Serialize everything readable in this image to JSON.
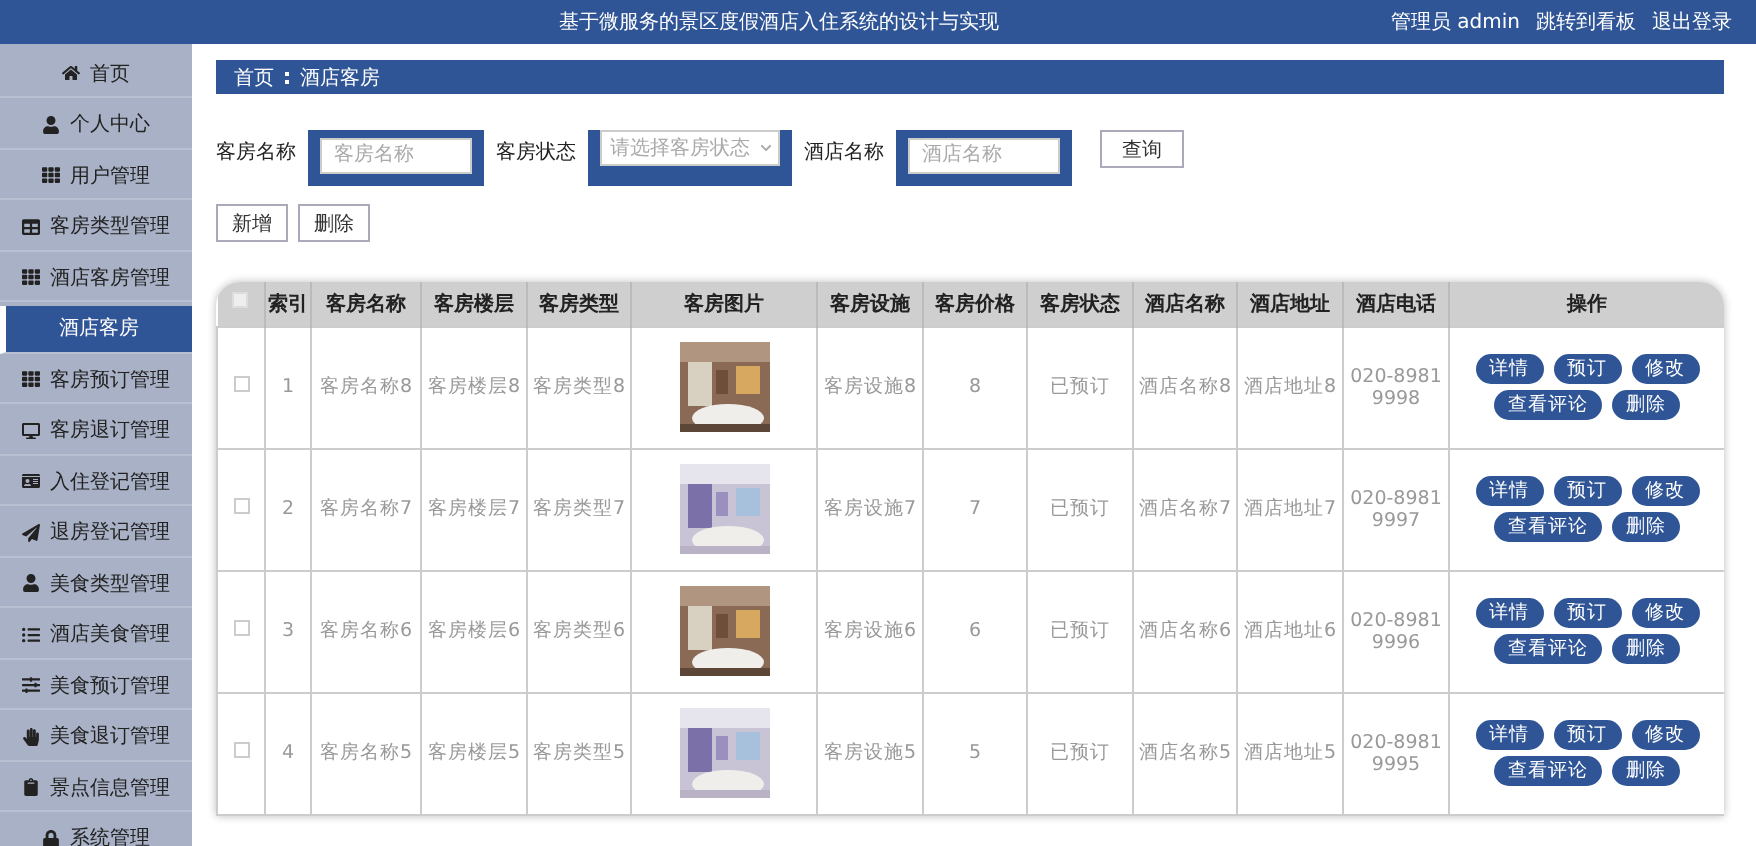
{
  "header": {
    "title": "基于微服务的景区度假酒店入住系统的设计与实现",
    "user": "管理员 admin",
    "links": [
      "跳转到看板",
      "退出登录"
    ]
  },
  "sidebar": {
    "items": [
      {
        "label": "首页",
        "selected": false
      },
      {
        "label": "个人中心",
        "selected": false
      },
      {
        "label": "用户管理",
        "selected": false
      },
      {
        "label": "客房类型管理",
        "selected": false
      },
      {
        "label": "酒店客房管理",
        "selected": false
      },
      {
        "label": "酒店客房",
        "selected": true
      },
      {
        "label": "客房预订管理",
        "selected": false
      },
      {
        "label": "客房退订管理",
        "selected": false
      },
      {
        "label": "入住登记管理",
        "selected": false
      },
      {
        "label": "退房登记管理",
        "selected": false
      },
      {
        "label": "美食类型管理",
        "selected": false
      },
      {
        "label": "酒店美食管理",
        "selected": false
      },
      {
        "label": "美食预订管理",
        "selected": false
      },
      {
        "label": "美食退订管理",
        "selected": false
      },
      {
        "label": "景点信息管理",
        "selected": false
      },
      {
        "label": "系统管理",
        "selected": false
      }
    ]
  },
  "breadcrumb": [
    "首页",
    "酒店客房"
  ],
  "search": {
    "fields": [
      {
        "label": "客房名称",
        "kind": "text",
        "placeholder": "客房名称"
      },
      {
        "label": "客房状态",
        "kind": "select",
        "placeholder": "请选择客房状态"
      },
      {
        "label": "酒店名称",
        "kind": "text",
        "placeholder": "酒店名称"
      }
    ],
    "button": "查询"
  },
  "actions": [
    "新增",
    "删除"
  ],
  "table": {
    "select_all_checked": false,
    "columns": [
      "索引",
      "客房名称",
      "客房楼层",
      "客房类型",
      "客房图片",
      "客房设施",
      "客房价格",
      "客房状态",
      "酒店名称",
      "酒店地址",
      "酒店电话",
      "操作"
    ],
    "rows": [
      {
        "checked": false,
        "cells": [
          "1",
          "客房名称8",
          "客房楼层8",
          "客房类型8",
          "",
          "客房设施8",
          "8",
          "已预订",
          "酒店名称8",
          "酒店地址8",
          "020-89819998"
        ],
        "buttons": [
          "详情",
          "预订",
          "修改",
          "查看评论",
          "删除"
        ]
      },
      {
        "checked": false,
        "cells": [
          "2",
          "客房名称7",
          "客房楼层7",
          "客房类型7",
          "",
          "客房设施7",
          "7",
          "已预订",
          "酒店名称7",
          "酒店地址7",
          "020-89819997"
        ],
        "buttons": [
          "详情",
          "预订",
          "修改",
          "查看评论",
          "删除"
        ]
      },
      {
        "checked": false,
        "cells": [
          "3",
          "客房名称6",
          "客房楼层6",
          "客房类型6",
          "",
          "客房设施6",
          "6",
          "已预订",
          "酒店名称6",
          "酒店地址6",
          "020-89819996"
        ],
        "buttons": [
          "详情",
          "预订",
          "修改",
          "查看评论",
          "删除"
        ]
      },
      {
        "checked": false,
        "cells": [
          "4",
          "客房名称5",
          "客房楼层5",
          "客房类型5",
          "",
          "客房设施5",
          "5",
          "已预订",
          "酒店名称5",
          "酒店地址5",
          "020-89819995"
        ],
        "buttons": [
          "详情",
          "预订",
          "修改",
          "查看评论",
          "删除"
        ]
      }
    ]
  }
}
